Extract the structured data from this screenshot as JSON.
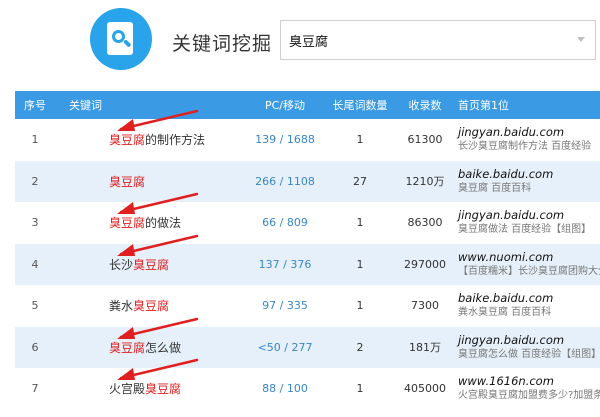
{
  "header": {
    "title": "关键词挖掘",
    "search_value": "臭豆腐",
    "accent_color": "#29a3ea",
    "logo_icon": "search-document-icon"
  },
  "table": {
    "header_color": "#3a9be4",
    "columns": [
      "序号",
      "关键词",
      "PC/移动",
      "长尾词数量",
      "收录数",
      "首页第1位"
    ],
    "highlight_color": "#e02020",
    "rows": [
      {
        "index": "1",
        "kw_pre": "",
        "kw_hl": "臭豆腐",
        "kw_post": "的制作方法",
        "pc_mobile": "139 / 1688",
        "longtail": "1",
        "indexed": "61300",
        "domain": "jingyan.baidu.com",
        "snippet": "长沙臭豆腐制作方法 百度经验",
        "arrow": true
      },
      {
        "index": "2",
        "kw_pre": "",
        "kw_hl": "臭豆腐",
        "kw_post": "",
        "pc_mobile": "266 / 1108",
        "longtail": "27",
        "indexed": "1210万",
        "domain": "baike.baidu.com",
        "snippet": "臭豆腐 百度百科",
        "arrow": false
      },
      {
        "index": "3",
        "kw_pre": "",
        "kw_hl": "臭豆腐",
        "kw_post": "的做法",
        "pc_mobile": "66 / 809",
        "longtail": "1",
        "indexed": "86300",
        "domain": "jingyan.baidu.com",
        "snippet": "臭豆腐做法 百度经验【组图】",
        "arrow": true
      },
      {
        "index": "4",
        "kw_pre": "长沙",
        "kw_hl": "臭豆腐",
        "kw_post": "",
        "pc_mobile": "137 / 376",
        "longtail": "1",
        "indexed": "297000",
        "domain": "www.nuomi.com",
        "snippet": "【百度糯米】长沙臭豆腐团购大全...",
        "arrow": true
      },
      {
        "index": "5",
        "kw_pre": "粪水",
        "kw_hl": "臭豆腐",
        "kw_post": "",
        "pc_mobile": "97 / 335",
        "longtail": "1",
        "indexed": "7300",
        "domain": "baike.baidu.com",
        "snippet": "粪水臭豆腐 百度百科",
        "arrow": false
      },
      {
        "index": "6",
        "kw_pre": "",
        "kw_hl": "臭豆腐",
        "kw_post": "怎么做",
        "pc_mobile": "<50 / 277",
        "longtail": "2",
        "indexed": "181万",
        "domain": "jingyan.baidu.com",
        "snippet": "臭豆腐怎么做 百度经验【组图】",
        "arrow": true
      },
      {
        "index": "7",
        "kw_pre": "火宫殿",
        "kw_hl": "臭豆腐",
        "kw_post": "",
        "pc_mobile": "88 / 100",
        "longtail": "1",
        "indexed": "405000",
        "domain": "www.1616n.com",
        "snippet": "火宫殿臭豆腐加盟费多少?加盟条...",
        "arrow": true
      }
    ]
  }
}
